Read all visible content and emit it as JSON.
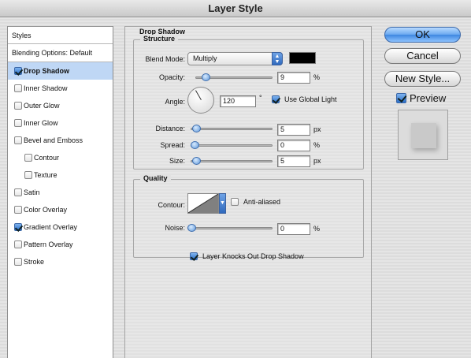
{
  "window": {
    "title": "Layer Style"
  },
  "styles_list": {
    "header": "Styles",
    "blending": "Blending Options: Default",
    "items": [
      {
        "label": "Drop Shadow",
        "checked": true,
        "selected": true,
        "sub": false
      },
      {
        "label": "Inner Shadow",
        "checked": false,
        "selected": false,
        "sub": false
      },
      {
        "label": "Outer Glow",
        "checked": false,
        "selected": false,
        "sub": false
      },
      {
        "label": "Inner Glow",
        "checked": false,
        "selected": false,
        "sub": false
      },
      {
        "label": "Bevel and Emboss",
        "checked": false,
        "selected": false,
        "sub": false
      },
      {
        "label": "Contour",
        "checked": false,
        "selected": false,
        "sub": true
      },
      {
        "label": "Texture",
        "checked": false,
        "selected": false,
        "sub": true
      },
      {
        "label": "Satin",
        "checked": false,
        "selected": false,
        "sub": false
      },
      {
        "label": "Color Overlay",
        "checked": false,
        "selected": false,
        "sub": false
      },
      {
        "label": "Gradient Overlay",
        "checked": true,
        "selected": false,
        "sub": false
      },
      {
        "label": "Pattern Overlay",
        "checked": false,
        "selected": false,
        "sub": false
      },
      {
        "label": "Stroke",
        "checked": false,
        "selected": false,
        "sub": false
      }
    ]
  },
  "panel": {
    "title": "Drop Shadow",
    "structure": {
      "title": "Structure",
      "blend_mode_label": "Blend Mode:",
      "blend_mode_value": "Multiply",
      "shadow_color": "#000000",
      "opacity_label": "Opacity:",
      "opacity_value": "9",
      "opacity_unit": "%",
      "opacity_fraction": 0.09,
      "angle_label": "Angle:",
      "angle_value": "120",
      "angle_unit": "°",
      "global_light_label": "Use Global Light",
      "global_light_checked": true,
      "distance_label": "Distance:",
      "distance_value": "5",
      "distance_unit": "px",
      "distance_fraction": 0.02,
      "spread_label": "Spread:",
      "spread_value": "0",
      "spread_unit": "%",
      "spread_fraction": 0.0,
      "size_label": "Size:",
      "size_value": "5",
      "size_unit": "px",
      "size_fraction": 0.02
    },
    "quality": {
      "title": "Quality",
      "contour_label": "Contour:",
      "anti_aliased_label": "Anti-aliased",
      "anti_aliased_checked": false,
      "noise_label": "Noise:",
      "noise_value": "0",
      "noise_unit": "%",
      "noise_fraction": 0.0
    },
    "knockout_label": "Layer Knocks Out Drop Shadow",
    "knockout_checked": true
  },
  "buttons": {
    "ok": "OK",
    "cancel": "Cancel",
    "new_style": "New Style...",
    "preview_label": "Preview",
    "preview_checked": true
  },
  "colors": {
    "accent": "#3d86e0",
    "selection": "#bfd7f5"
  }
}
